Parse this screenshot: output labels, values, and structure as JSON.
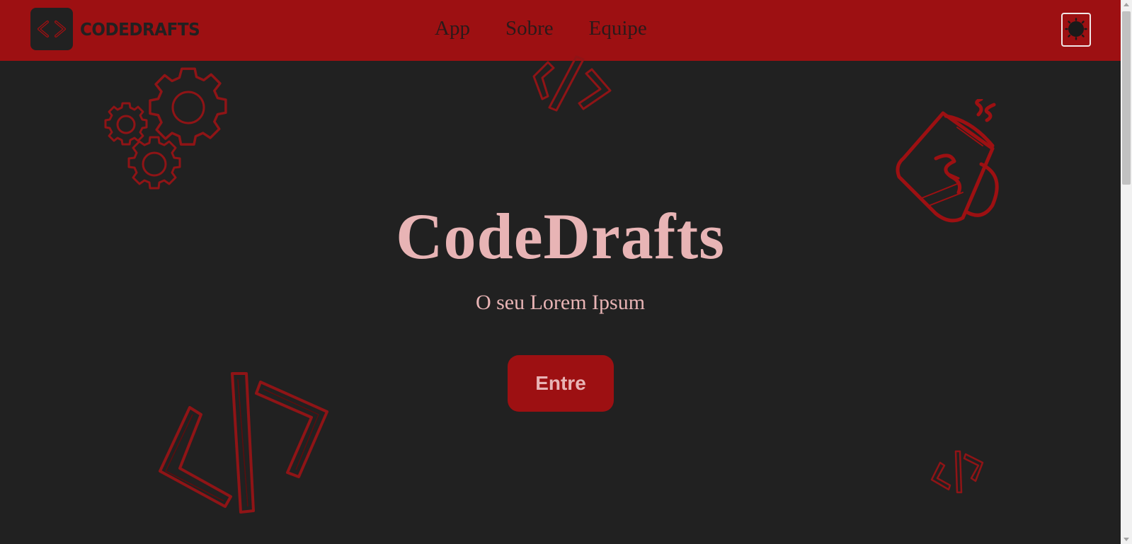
{
  "brand": {
    "name": "CODEDRAFTS",
    "logo_icon": "code-brackets-icon"
  },
  "nav": {
    "items": [
      {
        "label": "App"
      },
      {
        "label": "Sobre"
      },
      {
        "label": "Equipe"
      }
    ],
    "theme_toggle_icon": "sun-icon"
  },
  "hero": {
    "title": "CodeDrafts",
    "subtitle": "O seu Lorem Ipsum",
    "cta_label": "Entre"
  },
  "decorations": [
    "gears-icon",
    "code-tag-icon",
    "coffee-mug-icon",
    "code-tag-large-icon",
    "code-tag-small-icon"
  ],
  "colors": {
    "accent": "#9d1012",
    "background": "#212121",
    "text_light": "#e8b4b5",
    "nav_text": "#2a1a1a"
  }
}
